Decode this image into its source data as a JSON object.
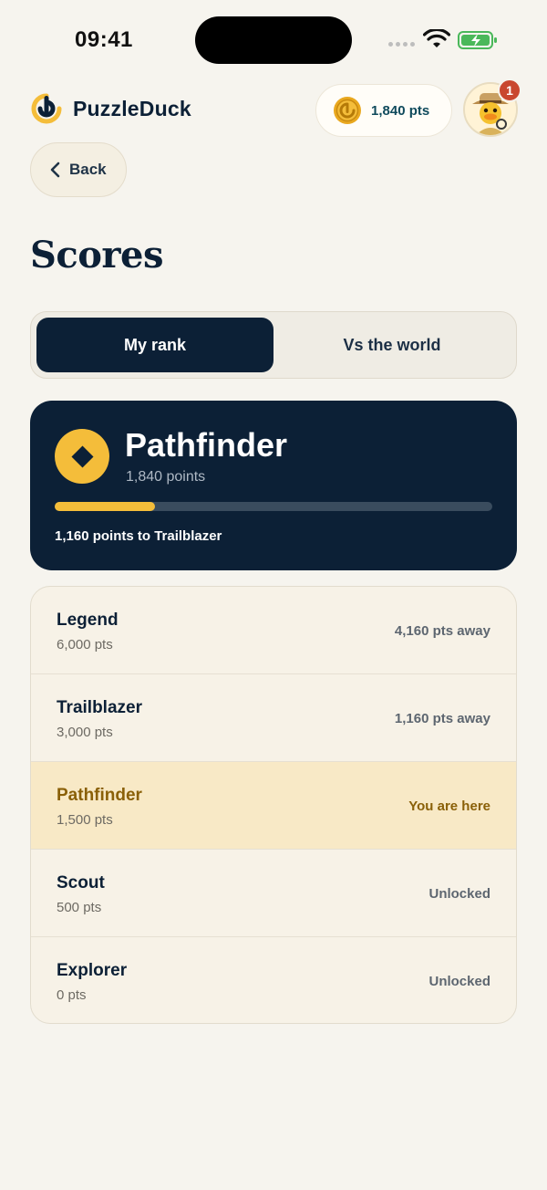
{
  "status_bar": {
    "time": "09:41"
  },
  "header": {
    "app_name": "PuzzleDuck",
    "points_label": "1,840 pts",
    "notification_count": "1"
  },
  "back_button": {
    "label": "Back"
  },
  "page_title": "Scores",
  "tabs": [
    {
      "label": "My rank",
      "active": true
    },
    {
      "label": "Vs the world",
      "active": false
    }
  ],
  "rank_card": {
    "name": "Pathfinder",
    "points": "1,840 points",
    "progress_fraction": 0.23,
    "caption": "1,160 points to Trailblazer"
  },
  "tiers": [
    {
      "name": "Legend",
      "points": "6,000 pts",
      "status": "4,160 pts away",
      "current": false
    },
    {
      "name": "Trailblazer",
      "points": "3,000 pts",
      "status": "1,160 pts away",
      "current": false
    },
    {
      "name": "Pathfinder",
      "points": "1,500 pts",
      "status": "You are here",
      "current": true
    },
    {
      "name": "Scout",
      "points": "500 pts",
      "status": "Unlocked",
      "current": false
    },
    {
      "name": "Explorer",
      "points": "0 pts",
      "status": "Unlocked",
      "current": false
    }
  ],
  "colors": {
    "navy": "#0c2036",
    "gold": "#f4bd3a",
    "background": "#f6f4ee",
    "highlight": "#f8e9c6",
    "badge": "#c9472f"
  }
}
